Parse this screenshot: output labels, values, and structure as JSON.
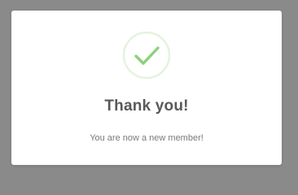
{
  "dialog": {
    "title": "Thank you!",
    "message": "You are now a new member!",
    "icon": "checkmark-success-icon"
  },
  "colors": {
    "backdrop": "#8a8a8a",
    "dialog_background": "#ffffff",
    "check_color": "#8dd07a",
    "check_ring": "#e4f3de",
    "title_color": "#595959",
    "message_color": "#7a7a7a"
  }
}
